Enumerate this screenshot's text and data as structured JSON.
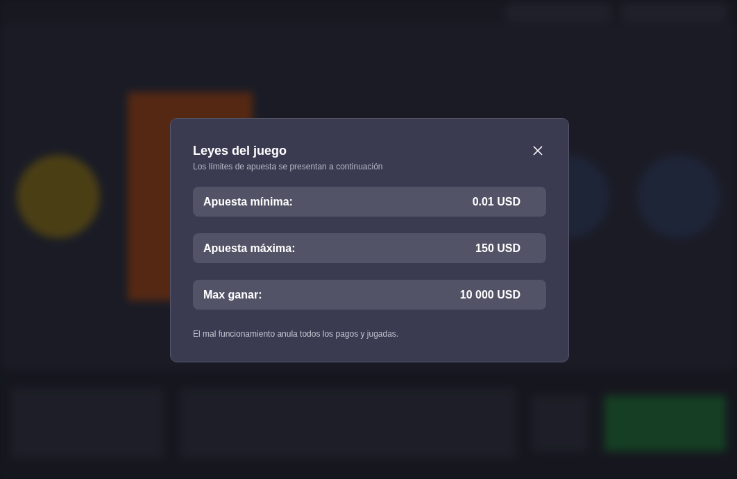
{
  "dialog": {
    "title": "Leyes del juego",
    "subtitle": "Los límites de apuesta se presentan a continuación",
    "limits": [
      {
        "label": "Apuesta mínima:",
        "value": "0.01 USD"
      },
      {
        "label": "Apuesta máxima:",
        "value": "150 USD"
      },
      {
        "label": "Max ganar:",
        "value": "10 000 USD"
      }
    ],
    "footnote": "El mal funcionamiento anula todos los pagos y jugadas."
  }
}
